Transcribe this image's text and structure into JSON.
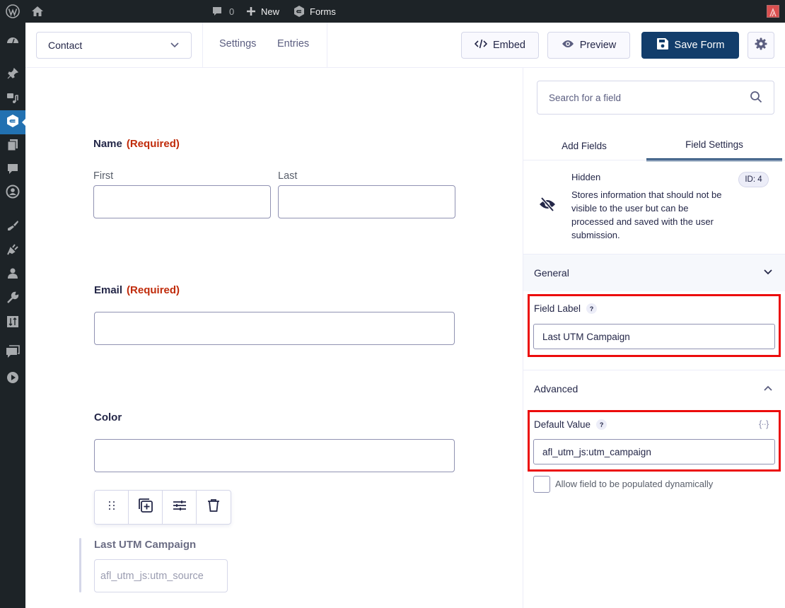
{
  "adminbar": {
    "comments_count": "0",
    "new_label": "New",
    "forms_label": "Forms"
  },
  "sidebar": {
    "items": [
      {
        "name": "dashboard"
      },
      {
        "name": "posts"
      },
      {
        "name": "media"
      },
      {
        "name": "forms",
        "active": true
      },
      {
        "name": "pages"
      },
      {
        "name": "comments"
      },
      {
        "name": "profile-builder"
      },
      {
        "name": "appearance"
      },
      {
        "name": "plugins"
      },
      {
        "name": "users"
      },
      {
        "name": "tools"
      },
      {
        "name": "settings"
      },
      {
        "name": "feedback"
      },
      {
        "name": "media-player"
      }
    ]
  },
  "topbar": {
    "form_selector": "Contact",
    "links": [
      "Settings",
      "Entries"
    ],
    "embed_label": "Embed",
    "preview_label": "Preview",
    "save_label": "Save Form"
  },
  "form": {
    "name_field": {
      "label": "Name",
      "required": "(Required)",
      "first_label": "First",
      "last_label": "Last"
    },
    "email_field": {
      "label": "Email",
      "required": "(Required)"
    },
    "color_field": {
      "label": "Color"
    },
    "hidden_field": {
      "label": "Last UTM Campaign",
      "value": "afl_utm_js:utm_source"
    }
  },
  "panel": {
    "search_placeholder": "Search for a field",
    "tabs": [
      "Add Fields",
      "Field Settings"
    ],
    "active_tab": "Field Settings",
    "field_info": {
      "title": "Hidden",
      "description": "Stores information that should not be visible to the user but can be processed and saved with the user submission.",
      "id_badge": "ID: 4"
    },
    "general": {
      "title": "General",
      "field_label_title": "Field Label",
      "field_label_value": "Last UTM Campaign"
    },
    "advanced": {
      "title": "Advanced",
      "default_value_title": "Default Value",
      "default_value": "afl_utm_js:utm_campaign",
      "dynamic_checkbox_label": "Allow field to be populated dynamically",
      "dynamic_checked": false
    },
    "help_glyph": "?",
    "merge_tag_glyph": "{··}"
  },
  "colors": {
    "primary": "#123d6b",
    "required": "#c02b0a",
    "highlight": "#ec0c0c",
    "admin_active": "#2271b1"
  }
}
